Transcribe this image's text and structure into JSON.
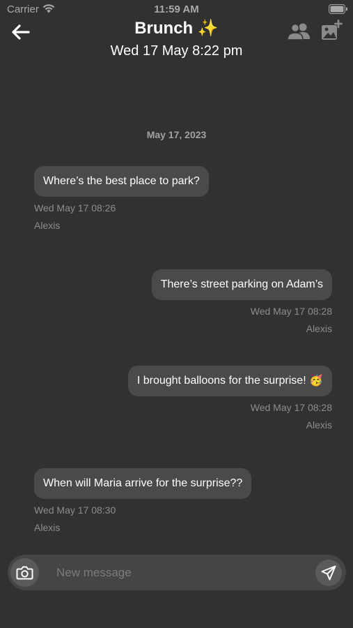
{
  "status_bar": {
    "carrier": "Carrier",
    "time": "11:59 AM"
  },
  "header": {
    "title": "Brunch ✨",
    "subtitle": "Wed 17 May 8:22 pm",
    "back_icon": "arrow-left-icon",
    "members_icon": "people-icon",
    "add_image_icon": "image-plus-icon"
  },
  "chat": {
    "date_separator": "May 17, 2023",
    "messages": [
      {
        "text": "Where’s the best place to park?",
        "time": "Wed May 17 08:26",
        "author": "Alexis",
        "side": "left"
      },
      {
        "text": "There’s street parking on Adam’s",
        "time": "Wed May 17 08:28",
        "author": "Alexis",
        "side": "right"
      },
      {
        "text": "I brought balloons for the surprise! 🥳",
        "time": "Wed May 17 08:28",
        "author": "Alexis",
        "side": "right"
      },
      {
        "text": "When will Maria arrive for the surprise??",
        "time": "Wed May 17 08:30",
        "author": "Alexis",
        "side": "left"
      }
    ]
  },
  "composer": {
    "placeholder": "New message",
    "value": "",
    "camera_icon": "camera-icon",
    "send_icon": "send-icon"
  },
  "colors": {
    "background": "#313131",
    "bubble": "#4a4a4a",
    "meta_text": "#8d8d8d",
    "composer": "#454545"
  }
}
